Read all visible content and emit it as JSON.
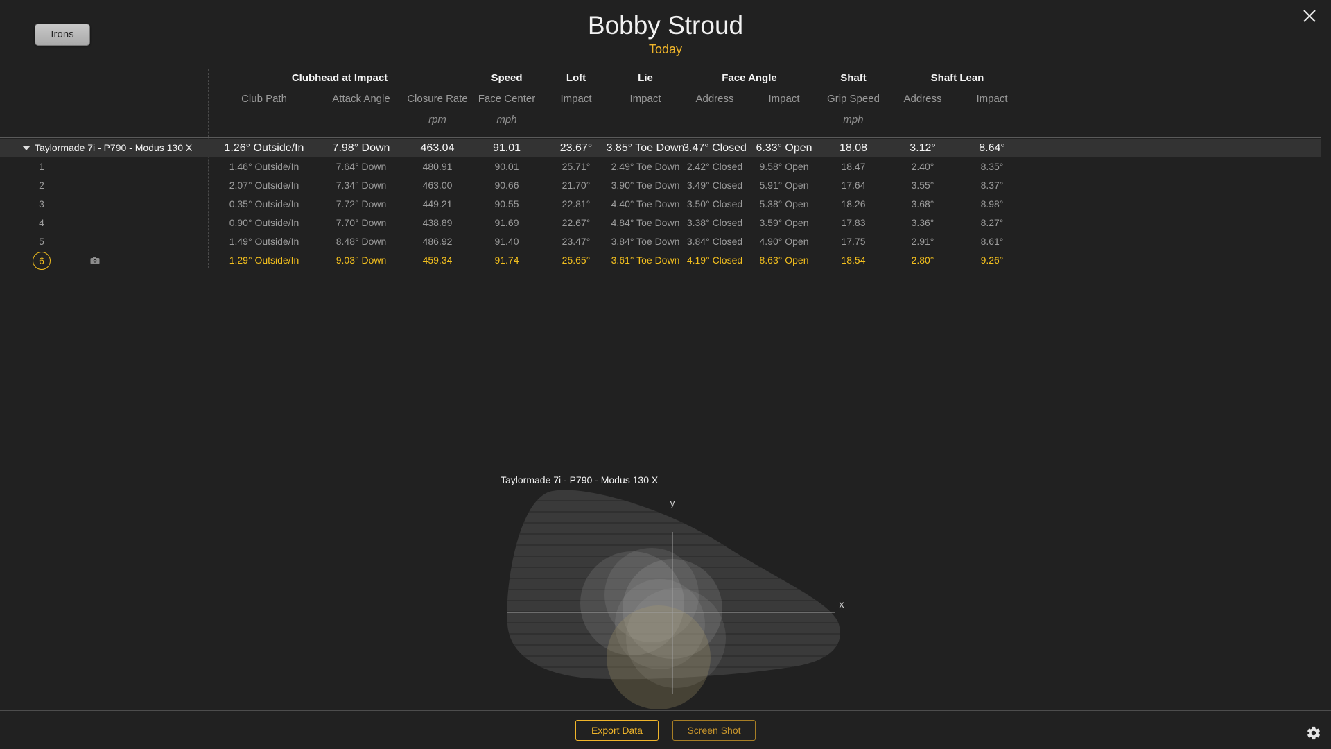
{
  "app": {
    "player_name": "Bobby Stroud",
    "date_label": "Today",
    "club_category_button": "Irons"
  },
  "columns": [
    {
      "group": "Clubhead at Impact",
      "name": "Club Path",
      "unit": ""
    },
    {
      "group": "",
      "name": "Attack Angle",
      "unit": ""
    },
    {
      "group": "",
      "name": "Closure Rate",
      "unit": "rpm"
    },
    {
      "group": "Speed",
      "name": "Face Center",
      "unit": "mph"
    },
    {
      "group": "Loft",
      "name": "Impact",
      "unit": ""
    },
    {
      "group": "Lie",
      "name": "Impact",
      "unit": ""
    },
    {
      "group": "Face Angle",
      "name": "Address",
      "unit": ""
    },
    {
      "group": "",
      "name": "Impact",
      "unit": ""
    },
    {
      "group": "Shaft",
      "name": "Grip Speed",
      "unit": "mph"
    },
    {
      "group": "Shaft Lean",
      "name": "Address",
      "unit": ""
    },
    {
      "group": "",
      "name": "Impact",
      "unit": ""
    }
  ],
  "header_groups": {
    "clubhead": "Clubhead at Impact",
    "speed": "Speed",
    "loft": "Loft",
    "lie": "Lie",
    "face_angle": "Face Angle",
    "shaft": "Shaft",
    "shaft_lean": "Shaft Lean"
  },
  "header_subs": {
    "club_path": "Club Path",
    "attack_angle": "Attack Angle",
    "closure_rate": "Closure Rate",
    "face_center": "Face Center",
    "loft_impact": "Impact",
    "lie_impact": "Impact",
    "face_address": "Address",
    "face_impact": "Impact",
    "grip_speed": "Grip Speed",
    "lean_address": "Address",
    "lean_impact": "Impact"
  },
  "header_units": {
    "closure_rate": "rpm",
    "face_center": "mph",
    "grip_speed": "mph"
  },
  "group": {
    "name": "Taylormade 7i - P790 -  Modus 130 X",
    "values": [
      "1.26° Outside/In",
      "7.98° Down",
      "463.04",
      "91.01",
      "23.67°",
      "3.85° Toe Down",
      "3.47° Closed",
      "6.33° Open",
      "18.08",
      "3.12°",
      "8.64°"
    ]
  },
  "shots": [
    {
      "num": "1",
      "values": [
        "1.46° Outside/In",
        "7.64° Down",
        "480.91",
        "90.01",
        "25.71°",
        "2.49° Toe Down",
        "2.42° Closed",
        "9.58° Open",
        "18.47",
        "2.40°",
        "8.35°"
      ]
    },
    {
      "num": "2",
      "values": [
        "2.07° Outside/In",
        "7.34° Down",
        "463.00",
        "90.66",
        "21.70°",
        "3.90° Toe Down",
        "3.49° Closed",
        "5.91° Open",
        "17.64",
        "3.55°",
        "8.37°"
      ]
    },
    {
      "num": "3",
      "values": [
        "0.35° Outside/In",
        "7.72° Down",
        "449.21",
        "90.55",
        "22.81°",
        "4.40° Toe Down",
        "3.50° Closed",
        "5.38° Open",
        "18.26",
        "3.68°",
        "8.98°"
      ]
    },
    {
      "num": "4",
      "values": [
        "0.90° Outside/In",
        "7.70° Down",
        "438.89",
        "91.69",
        "22.67°",
        "4.84° Toe Down",
        "3.38° Closed",
        "3.59° Open",
        "17.83",
        "3.36°",
        "8.27°"
      ]
    },
    {
      "num": "5",
      "values": [
        "1.49° Outside/In",
        "8.48° Down",
        "486.92",
        "91.40",
        "23.47°",
        "3.84° Toe Down",
        "3.84° Closed",
        "4.90° Open",
        "17.75",
        "2.91°",
        "8.61°"
      ]
    },
    {
      "num": "6",
      "selected": true,
      "values": [
        "1.29° Outside/In",
        "9.03° Down",
        "459.34",
        "91.74",
        "25.65°",
        "3.61° Toe Down",
        "4.19° Closed",
        "8.63° Open",
        "18.54",
        "2.80°",
        "9.26°"
      ]
    }
  ],
  "impact_chart": {
    "title": "Taylormade 7i - P790 -  Modus 130 X",
    "x_axis_label": "x",
    "y_axis_label": "y"
  },
  "footer": {
    "export_label": "Export Data",
    "screenshot_label": "Screen Shot"
  },
  "icons": {
    "close": "close-icon",
    "settings": "gear-icon",
    "camera": "camera-icon",
    "expand": "triangle-down-icon"
  },
  "colors": {
    "accent": "#f0b52a",
    "selected_shot": "#f4c01e",
    "background": "#212121"
  }
}
